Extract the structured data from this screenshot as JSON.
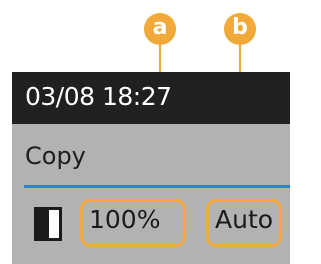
{
  "callouts": {
    "a": "a",
    "b": "b"
  },
  "screen": {
    "datetime": "03/08 18:27",
    "mode": "Copy",
    "copy_ratio": "100%",
    "paper_source": "Auto",
    "density_icon": "density-icon"
  },
  "colors": {
    "callout": "#f1a93a",
    "header_bg": "#202020",
    "panel_bg": "#b2b2b2",
    "divider": "#2f80d6"
  }
}
